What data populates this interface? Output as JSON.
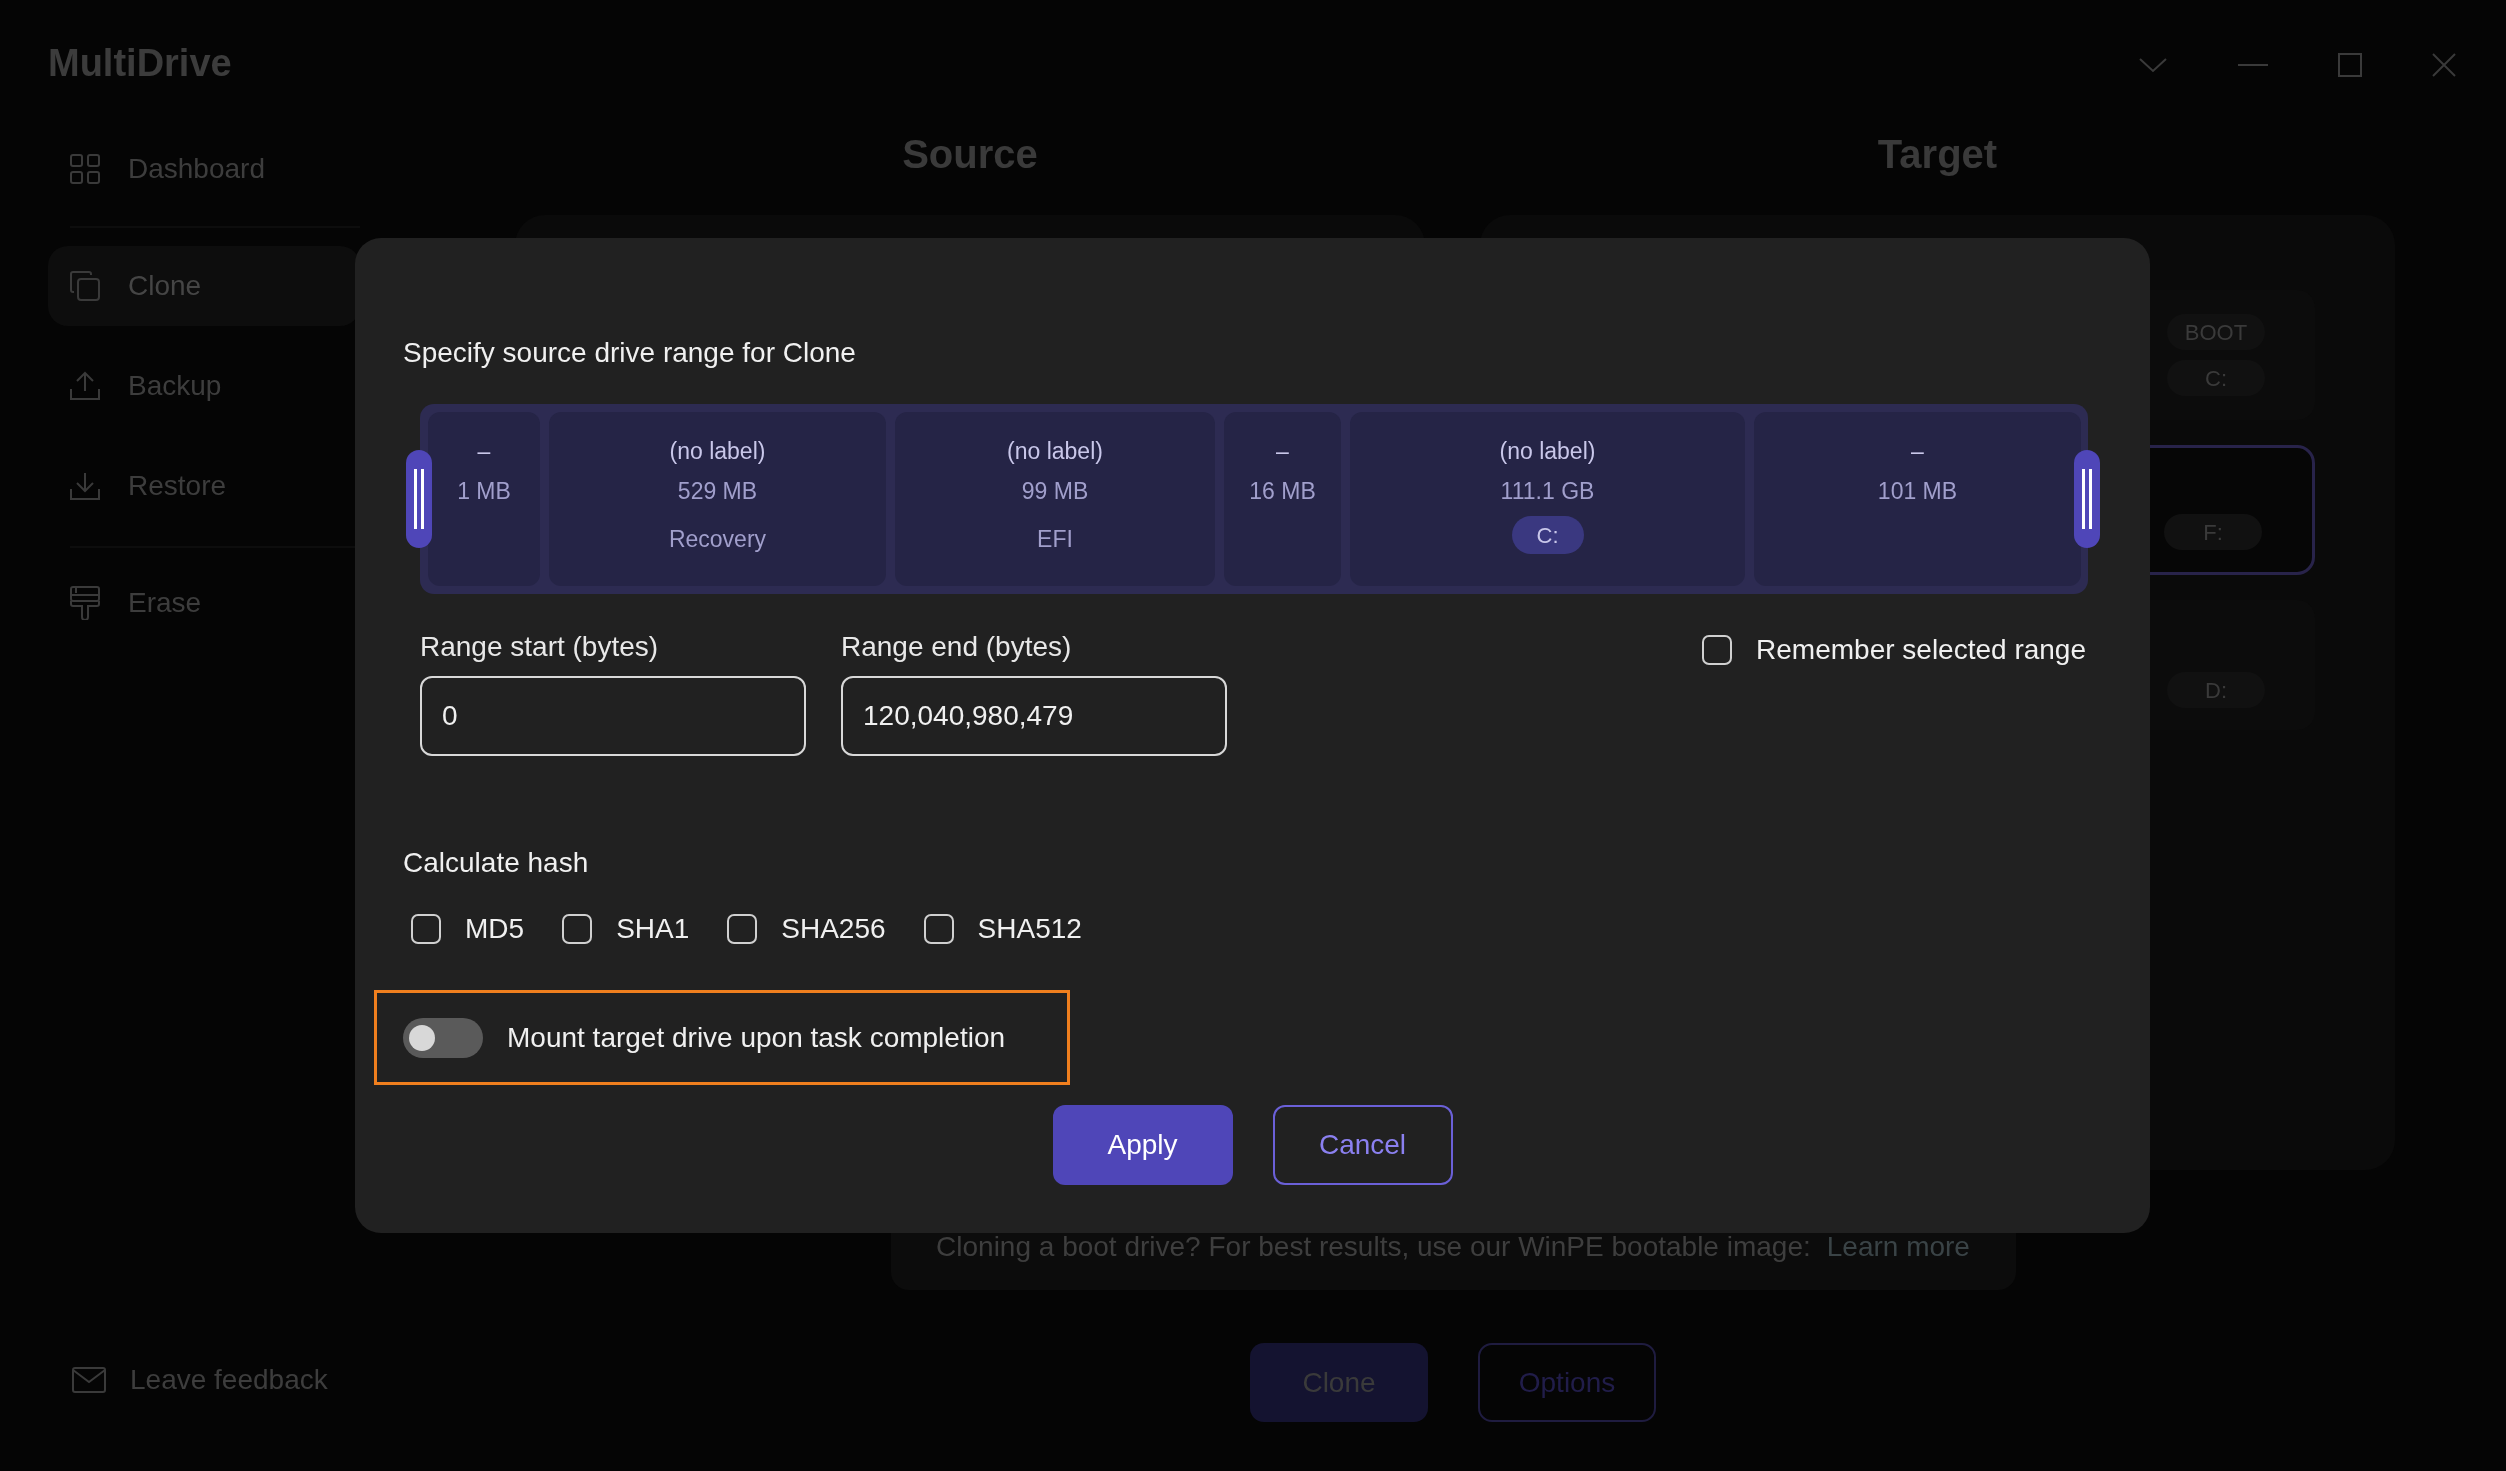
{
  "app": {
    "title": "MultiDrive"
  },
  "sidebar": {
    "items": [
      {
        "label": "Dashboard",
        "selected": false
      },
      {
        "label": "Clone",
        "selected": true
      },
      {
        "label": "Backup",
        "selected": false
      },
      {
        "label": "Restore",
        "selected": false
      },
      {
        "label": "Erase",
        "selected": false
      }
    ],
    "footer": "Leave feedback"
  },
  "source": {
    "heading": "Source"
  },
  "target": {
    "heading": "Target",
    "cards": [
      {
        "badges": [
          "BOOT",
          "C:"
        ],
        "selected": false
      },
      {
        "badges": [
          "F:"
        ],
        "selected": true
      },
      {
        "badges": [
          "D:"
        ],
        "selected": false
      }
    ]
  },
  "banner": {
    "text": "Cloning a boot drive? For best results, use our WinPE bootable image:",
    "link": "Learn more"
  },
  "actions": {
    "primary": "Clone",
    "secondary": "Options"
  },
  "dialog": {
    "heading": "Specify source drive range for Clone",
    "partitions": [
      {
        "name": "–",
        "size": "1 MB"
      },
      {
        "name": "(no label)",
        "size": "529 MB",
        "detail": "Recovery"
      },
      {
        "name": "(no label)",
        "size": "99 MB",
        "detail": "EFI"
      },
      {
        "name": "–",
        "size": "16 MB"
      },
      {
        "name": "(no label)",
        "size": "111.1 GB",
        "drive_letter": "C:"
      },
      {
        "name": "–",
        "size": "101 MB"
      }
    ],
    "range_start": {
      "label": "Range start (bytes)",
      "value": "0"
    },
    "range_end": {
      "label": "Range end (bytes)",
      "value": "120,040,980,479"
    },
    "remember": {
      "label": "Remember selected range",
      "checked": false
    },
    "hash": {
      "label": "Calculate hash",
      "options": [
        {
          "label": "MD5",
          "checked": false
        },
        {
          "label": "SHA1",
          "checked": false
        },
        {
          "label": "SHA256",
          "checked": false
        },
        {
          "label": "SHA512",
          "checked": false
        }
      ]
    },
    "mount": {
      "label": "Mount target drive upon task completion",
      "on": false
    },
    "buttons": {
      "apply": "Apply",
      "cancel": "Cancel"
    }
  }
}
